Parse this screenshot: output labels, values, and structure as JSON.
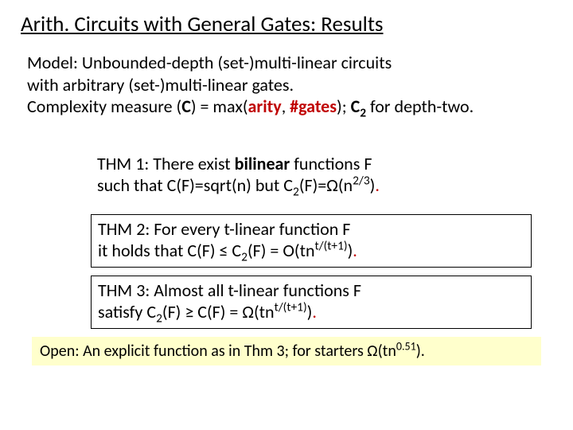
{
  "title": "Arith. Circuits  with General Gates: Results",
  "model": {
    "label": "Model:",
    "line1_rest": " Unbounded-depth (set-)multi-linear circuits",
    "line2": "with arbitrary (set-)multi-linear gates.",
    "line3_a": "Complexity measure (",
    "line3_C": "C",
    "line3_b": ") = max(",
    "line3_arity": "arity",
    "line3_c": ", ",
    "line3_gates": "#gates",
    "line3_d": "); ",
    "line3_C2": "C",
    "line3_sub2": "2",
    "line3_e": " for depth-two."
  },
  "thm1": {
    "a": "THM 1: There exist ",
    "bi": "bilinear",
    "b": " functions F",
    "c": "such that C(F)=sqrt(n) but C",
    "sub2": "2",
    "d": "(F)=",
    "omega": "Ω",
    "e": "(n",
    "sup": "2/3",
    "f": ")",
    "dot": "."
  },
  "thm2": {
    "a": "THM 2: For every t-linear function F",
    "b": "it holds that C(F) ≤ C",
    "sub2": "2",
    "c": "(F) = O(tn",
    "sup": "t/(t+1)",
    "d": ")",
    "dot": "."
  },
  "thm3": {
    "a": "THM 3: Almost all t-linear functions F",
    "b": "satisfy  C",
    "sub2": "2",
    "c": "(F) ≥ C(F) = ",
    "omega": "Ω",
    "d": "(tn",
    "sup": "t/(t+1)",
    "e": ")",
    "dot": "."
  },
  "open": {
    "label": "Open:",
    "a": " An explicit function as in Thm 3; for starters ",
    "omega": "Ω",
    "b": "(tn",
    "sup": "0.51",
    "c": ")."
  }
}
